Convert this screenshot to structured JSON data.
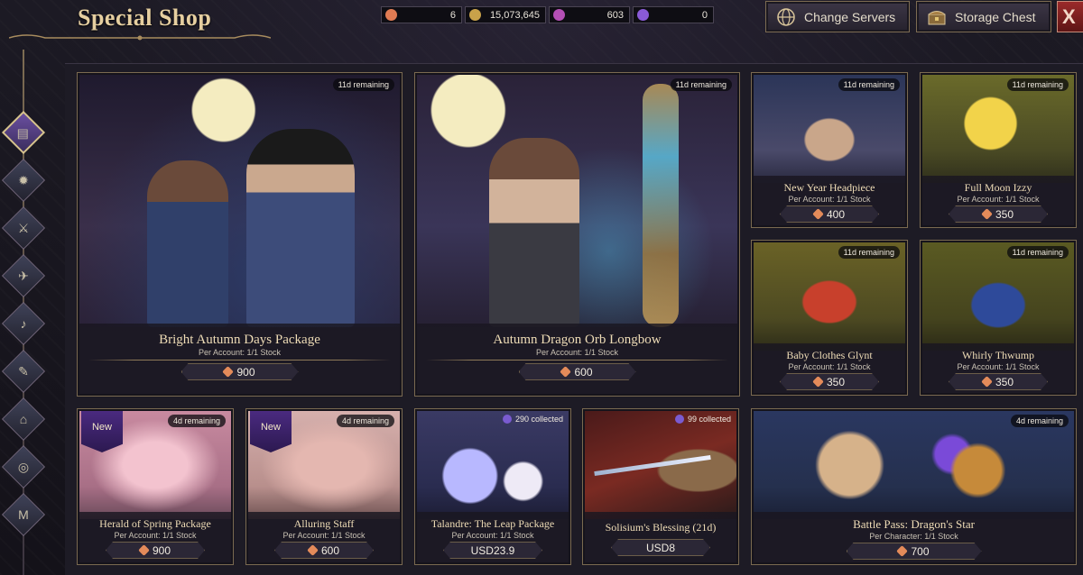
{
  "header": {
    "title": "Special Shop"
  },
  "currencies": [
    {
      "icon": "orange-gem-icon",
      "value": "6",
      "color": "#e07b53"
    },
    {
      "icon": "gold-coin-icon",
      "value": "15,073,645",
      "color": "#c9a24a"
    },
    {
      "icon": "purple-token-icon",
      "value": "603",
      "color": "#b44fb5"
    },
    {
      "icon": "violet-coin-icon",
      "value": "0",
      "color": "#8a5ad8"
    }
  ],
  "buttons": {
    "change_servers": "Change Servers",
    "storage_chest": "Storage Chest",
    "close": "X"
  },
  "sidebar": {
    "items": [
      {
        "icon": "special-shop-icon",
        "active": true
      },
      {
        "icon": "sun-emblem-icon"
      },
      {
        "icon": "sword-icon"
      },
      {
        "icon": "bird-icon"
      },
      {
        "icon": "horn-icon"
      },
      {
        "icon": "feather-icon"
      },
      {
        "icon": "house-icon"
      },
      {
        "icon": "orbs-icon"
      },
      {
        "icon": "m-coin-icon",
        "glyph": "M"
      }
    ]
  },
  "cards": [
    {
      "name": "Bright Autumn Days Package",
      "stock": "Per Account:  1/1 Stock",
      "price": "900",
      "currency": "orange-gem",
      "badge": "11d remaining"
    },
    {
      "name": "Autumn Dragon Orb Longbow",
      "stock": "Per Account:  1/1 Stock",
      "price": "600",
      "currency": "orange-gem",
      "badge": "11d remaining"
    },
    {
      "name": "New Year Headpiece",
      "stock": "Per Account:  1/1 Stock",
      "price": "400",
      "currency": "orange-gem",
      "badge": "11d remaining"
    },
    {
      "name": "Full Moon Izzy",
      "stock": "Per Account:  1/1 Stock",
      "price": "350",
      "currency": "orange-gem",
      "badge": "11d remaining"
    },
    {
      "name": "Baby Clothes Glynt",
      "stock": "Per Account:  1/1 Stock",
      "price": "350",
      "currency": "orange-gem",
      "badge": "11d remaining"
    },
    {
      "name": "Whirly Thwump",
      "stock": "Per Account:  1/1 Stock",
      "price": "350",
      "currency": "orange-gem",
      "badge": "11d remaining"
    },
    {
      "name": "Herald of Spring Package",
      "stock": "Per Account:  1/1 Stock",
      "price": "900",
      "currency": "orange-gem",
      "badge": "4d remaining",
      "flag": "New"
    },
    {
      "name": "Alluring Staff",
      "stock": "Per Account:  1/1 Stock",
      "price": "600",
      "currency": "orange-gem",
      "badge": "4d remaining",
      "flag": "New"
    },
    {
      "name": "Talandre: The Leap Package",
      "stock": "Per Account:  1/1 Stock",
      "price": "USD23.9",
      "badge": "290 collected"
    },
    {
      "name": "Solisium's Blessing (21d)",
      "stock": "",
      "price": "USD8",
      "badge": "99 collected"
    },
    {
      "name": "Battle Pass: Dragon's Star",
      "stock": "Per Character:  1/1 Stock",
      "price": "700",
      "currency": "orange-gem",
      "badge": "4d remaining"
    }
  ]
}
